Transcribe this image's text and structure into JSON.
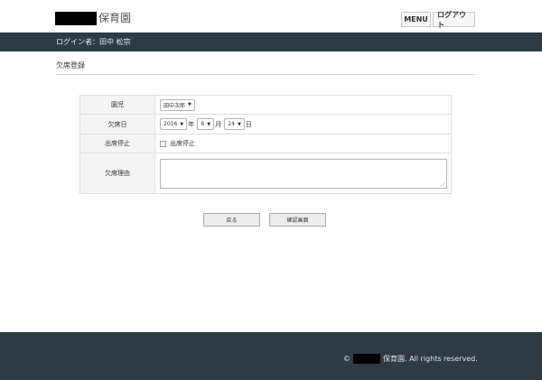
{
  "header": {
    "logo_text": "保育園",
    "menu_label": "MENU",
    "logout_label": "ログアウト"
  },
  "userbar": {
    "login_text": "ログイン者：田中 松宗"
  },
  "page": {
    "title": "欠席登録"
  },
  "form": {
    "child": {
      "label": "園児",
      "value": "田中次郎"
    },
    "absence_date": {
      "label": "欠席日",
      "year": "2016",
      "year_unit": "年",
      "month": "6",
      "month_unit": "月",
      "day": "24",
      "day_unit": "日"
    },
    "stop_attendance": {
      "label": "出席停止",
      "checkbox_label": "出席停止",
      "checked": false
    },
    "reason": {
      "label": "欠席理由",
      "value": ""
    }
  },
  "buttons": {
    "back": "戻る",
    "confirm": "確認画面"
  },
  "footer": {
    "copyright_symbol": "©",
    "copyright_text": "保育園. All rights reserved."
  }
}
